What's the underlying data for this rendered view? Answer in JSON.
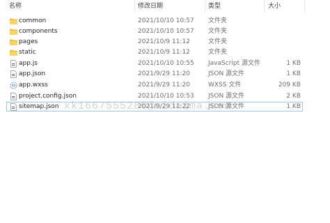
{
  "columns": {
    "name": "名称",
    "date": "修改日期",
    "type": "类型",
    "size": "大小"
  },
  "files": [
    {
      "name": "common",
      "date": "2021/10/10 10:57",
      "type": "文件夹",
      "size": "",
      "icon": "folder-icon"
    },
    {
      "name": "components",
      "date": "2021/10/10 10:57",
      "type": "文件夹",
      "size": "",
      "icon": "folder-icon"
    },
    {
      "name": "pages",
      "date": "2021/10/9 11:12",
      "type": "文件夹",
      "size": "",
      "icon": "folder-icon"
    },
    {
      "name": "static",
      "date": "2021/10/9 11:12",
      "type": "文件夹",
      "size": "",
      "icon": "folder-icon"
    },
    {
      "name": "app.js",
      "date": "2021/10/10 10:55",
      "type": "JavaScript 源文件",
      "size": "1 KB",
      "icon": "js-file-icon"
    },
    {
      "name": "app.json",
      "date": "2021/9/29 11:20",
      "type": "JSON 源文件",
      "size": "1 KB",
      "icon": "json-file-icon"
    },
    {
      "name": "app.wxss",
      "date": "2021/9/29 11:20",
      "type": "WXSS 文件",
      "size": "209 KB",
      "icon": "wxss-file-icon"
    },
    {
      "name": "project.config.json",
      "date": "2021/10/10 10:53",
      "type": "JSON 源文件",
      "size": "2 KB",
      "icon": "json-file-icon"
    },
    {
      "name": "sitemap.json",
      "date": "2021/9/29 11:22",
      "type": "JSON 源文件",
      "size": "1 KB",
      "icon": "json-file-icon"
    }
  ],
  "watermark": "xk1667555286@aidaima.com",
  "colors": {
    "selection_border": "#99c9ef",
    "folder": "#f5c244",
    "header_text": "#3d3d3d"
  }
}
